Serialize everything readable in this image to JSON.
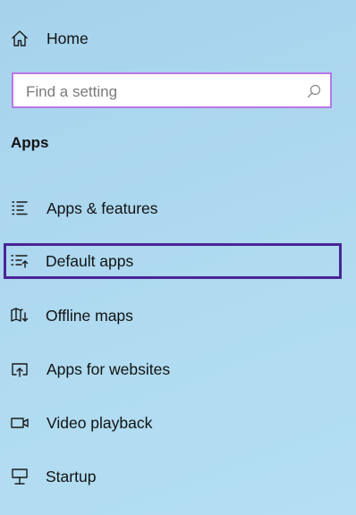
{
  "nav": {
    "home": {
      "label": "Home",
      "icon": "home-icon"
    }
  },
  "search": {
    "placeholder": "Find a setting",
    "icon": "search-icon",
    "border_color": "#b978e6"
  },
  "section": {
    "title": "Apps"
  },
  "menu": {
    "items": [
      {
        "label": "Apps & features",
        "icon": "apps-features-icon"
      },
      {
        "label": "Default apps",
        "icon": "default-apps-icon",
        "focused": true
      },
      {
        "label": "Offline maps",
        "icon": "offline-maps-icon"
      },
      {
        "label": "Apps for websites",
        "icon": "apps-for-websites-icon"
      },
      {
        "label": "Video playback",
        "icon": "video-playback-icon"
      },
      {
        "label": "Startup",
        "icon": "startup-icon"
      }
    ],
    "focus_color": "#4a2596"
  }
}
